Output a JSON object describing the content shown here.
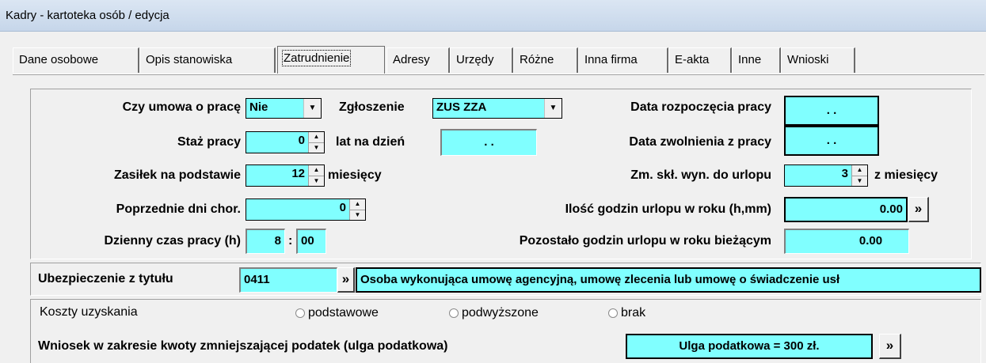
{
  "window": {
    "title": "Kadry - kartoteka osób / edycja"
  },
  "tabs": [
    {
      "label": "Dane osobowe"
    },
    {
      "label": "Opis stanowiska"
    },
    {
      "label": "Zatrudnienie"
    },
    {
      "label": "Adresy"
    },
    {
      "label": "Urzędy"
    },
    {
      "label": "Różne"
    },
    {
      "label": "Inna firma"
    },
    {
      "label": "E-akta"
    },
    {
      "label": "Inne"
    },
    {
      "label": "Wnioski"
    }
  ],
  "active_tab": "Zatrudnienie",
  "employment": {
    "contract_label": "Czy umowa o pracę",
    "contract_value": "Nie",
    "registration_label": "Zgłoszenie",
    "registration_value": "ZUS ZZA",
    "start_date_label": "Data rozpoczęcia pracy",
    "start_date_value": ". .",
    "seniority_label": "Staż pracy",
    "seniority_value": "0",
    "years_on_day_label": "lat na dzień",
    "years_on_day_value": ". .",
    "end_date_label": "Data zwolnienia z pracy",
    "end_date_value": ". .",
    "allowance_label": "Zasiłek na podstawie",
    "allowance_value": "12",
    "months_label": "miesięcy",
    "vacation_salary_label": "Zm. skł. wyn. do urlopu",
    "vacation_salary_value": "3",
    "of_months_label": "z miesięcy",
    "prev_sick_days_label": "Poprzednie dni chor.",
    "prev_sick_days_value": "0",
    "vacation_hours_label": "Ilość godzin urlopu w roku (h,mm)",
    "vacation_hours_value": "0.00",
    "daily_hours_label": "Dzienny czas pracy (h)",
    "daily_hours_h": "8",
    "daily_hours_sep": ":",
    "daily_hours_m": "00",
    "remaining_hours_label": "Pozostało godzin urlopu w roku bieżącym",
    "remaining_hours_value": "0.00"
  },
  "insurance": {
    "label": "Ubezpieczenie z tytułu",
    "code": "0411",
    "description": "Osoba wykonująca umowę agencyjną, umowę zlecenia lub umowę o świadczenie usł"
  },
  "costs": {
    "label": "Koszty uzyskania",
    "options": [
      "podstawowe",
      "podwyższone",
      "brak"
    ]
  },
  "tax": {
    "label": "Wniosek w zakresie kwoty zmniejszającej podatek (ulga podatkowa)",
    "value": "Ulga podatkowa = 300 zł."
  },
  "buttons": {
    "more": "»"
  },
  "icons": {
    "dropdown": "▼",
    "spin_up": "▲",
    "spin_down": "▼"
  }
}
